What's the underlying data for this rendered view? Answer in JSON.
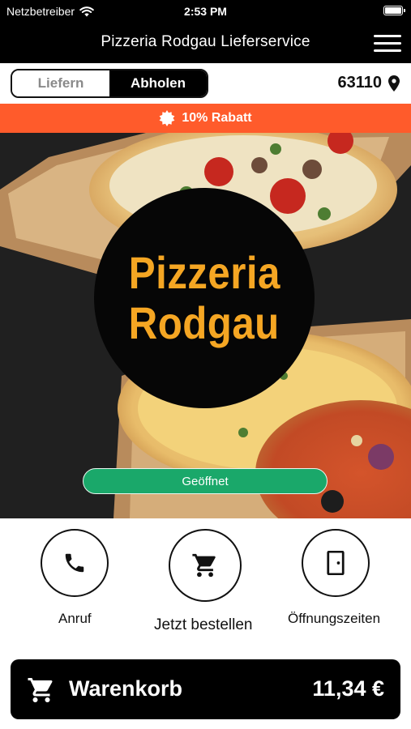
{
  "status_bar": {
    "carrier": "Netzbetreiber",
    "time": "2:53 PM"
  },
  "nav": {
    "title": "Pizzeria Rodgau Lieferservice",
    "menu_icon": "hamburger-menu-icon"
  },
  "mode_toggle": {
    "options": [
      "Liefern",
      "Abholen"
    ],
    "selected": "Abholen"
  },
  "location": {
    "zip": "63110",
    "icon": "location-pin-icon"
  },
  "promo": {
    "text": "10% Rabatt",
    "icon": "badge-star-icon",
    "color": "#ff5b2b"
  },
  "hero": {
    "logo_lines": [
      "Pizzeria",
      "Rodgau"
    ],
    "logo_color": "#f5a623",
    "status": "Geöffnet",
    "status_color": "#1aa86a"
  },
  "actions": [
    {
      "label": "Anruf",
      "icon": "phone-icon"
    },
    {
      "label": "Jetzt bestellen",
      "icon": "shopping-cart-icon"
    },
    {
      "label": "Öffnungszeiten",
      "icon": "door-icon"
    }
  ],
  "cart": {
    "label": "Warenkorb",
    "total": "11,34 €",
    "icon": "shopping-cart-icon"
  }
}
